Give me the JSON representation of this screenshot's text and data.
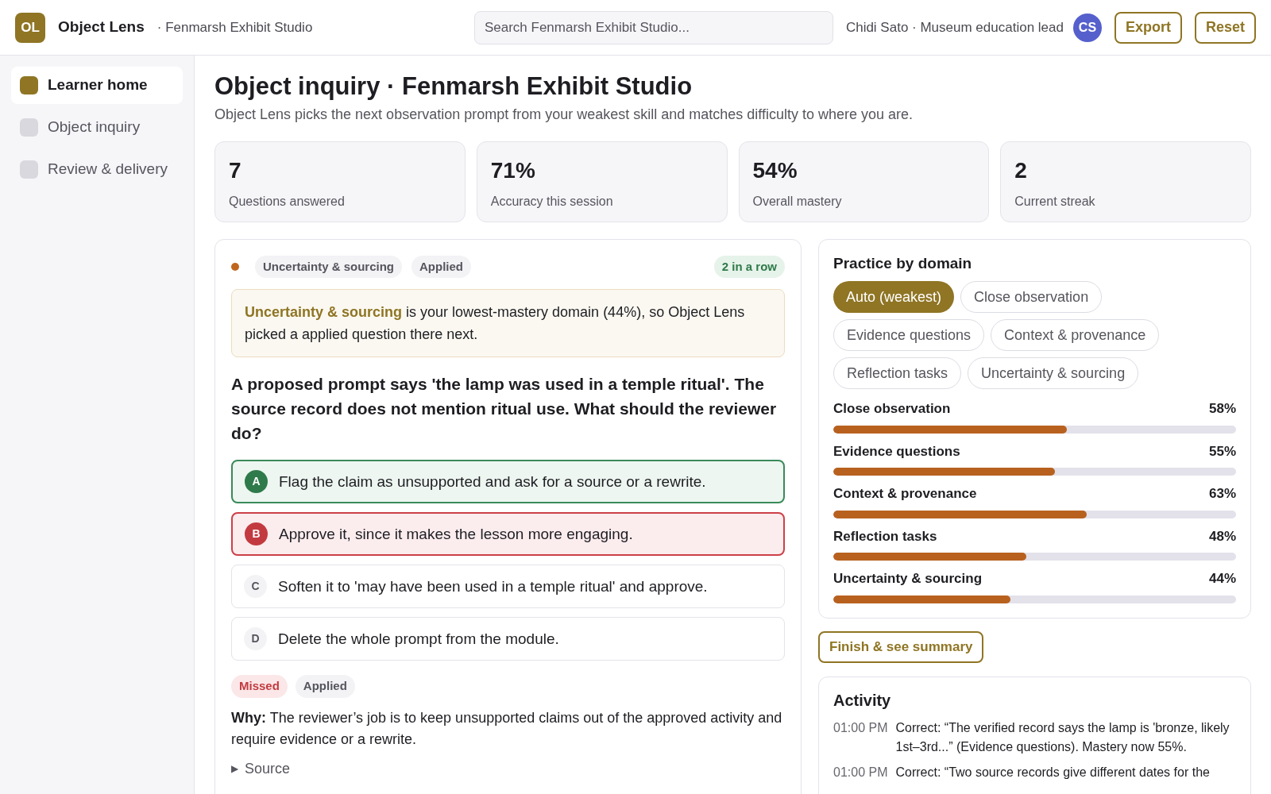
{
  "app": {
    "logo": "OL",
    "name": "Object Lens",
    "workspace": "· Fenmarsh Exhibit Studio"
  },
  "search": {
    "placeholder": "Search Fenmarsh Exhibit Studio..."
  },
  "user": {
    "label": "Chidi Sato · Museum education lead",
    "initials": "CS"
  },
  "header_buttons": [
    "Export",
    "Reset"
  ],
  "sidebar": {
    "items": [
      {
        "label": "Learner home",
        "selected": true
      },
      {
        "label": "Object inquiry",
        "selected": false
      },
      {
        "label": "Review & delivery",
        "selected": false
      }
    ]
  },
  "page": {
    "title": "Object inquiry · Fenmarsh Exhibit Studio",
    "subtitle": "Object Lens picks the next observation prompt from your weakest skill and matches difficulty to where you are."
  },
  "stats": [
    {
      "value": "7",
      "label": "Questions answered"
    },
    {
      "value": "71%",
      "label": "Accuracy this session"
    },
    {
      "value": "54%",
      "label": "Overall mastery"
    },
    {
      "value": "2",
      "label": "Current streak"
    }
  ],
  "question": {
    "domain": {
      "label": "Uncertainty & sourcing",
      "color": "#c0651e"
    },
    "level": "Applied",
    "streak": "2 in a row",
    "reason": "**Uncertainty & sourcing** is your lowest-mastery domain (44%), so Object Lens picked a applied question there next.",
    "prompt": "A proposed prompt says 'the lamp was used in a temple ritual'. The source record does not mention ritual use. What should the reviewer do?",
    "choices": [
      {
        "letter": "A",
        "text": "Flag the claim as unsupported and ask for a source or a rewrite.",
        "correct": true,
        "selected": false
      },
      {
        "letter": "B",
        "text": "Approve it, since it makes the lesson more engaging.",
        "correct": false,
        "selected": true
      },
      {
        "letter": "C",
        "text": "Soften it to 'may have been used in a temple ritual' and approve.",
        "correct": false,
        "selected": false
      },
      {
        "letter": "D",
        "text": "Delete the whole prompt from the module.",
        "correct": false,
        "selected": false
      }
    ],
    "outcome_tags": [
      {
        "label": "Missed",
        "kind": "missed"
      },
      {
        "label": "Applied",
        "kind": "level"
      }
    ],
    "explanation": "**Why:** The reviewer’s job is to keep unsupported claims out of the approved activity and require evidence or a rewrite.",
    "source_toggle": {
      "icon": "▶",
      "label": "Source",
      "expanded": false
    }
  },
  "practice": {
    "title": "Practice by domain",
    "filters": [
      {
        "label": "Auto (weakest)",
        "selected": true
      },
      {
        "label": "Close observation",
        "selected": false
      },
      {
        "label": "Evidence questions",
        "selected": false
      },
      {
        "label": "Context & provenance",
        "selected": false
      },
      {
        "label": "Reflection tasks",
        "selected": false
      },
      {
        "label": "Uncertainty & sourcing",
        "selected": false
      }
    ],
    "domains": [
      {
        "name": "Close observation",
        "reading": "58%",
        "level": 0.58
      },
      {
        "name": "Evidence questions",
        "reading": "55%",
        "level": 0.55
      },
      {
        "name": "Context & provenance",
        "reading": "63%",
        "level": 0.63
      },
      {
        "name": "Reflection tasks",
        "reading": "48%",
        "level": 0.48
      },
      {
        "name": "Uncertainty & sourcing",
        "reading": "44%",
        "level": 0.44
      }
    ]
  },
  "finish_button": "Finish & see summary",
  "activity": {
    "title": "Activity",
    "entries": [
      {
        "time": "01:00 PM",
        "text": "Correct: “The verified record says the lamp is 'bronze, likely 1st–3rd...” (Evidence questions). Mastery now 55%."
      },
      {
        "time": "01:00 PM",
        "text": "Correct: “Two source records give different dates for the"
      }
    ]
  }
}
